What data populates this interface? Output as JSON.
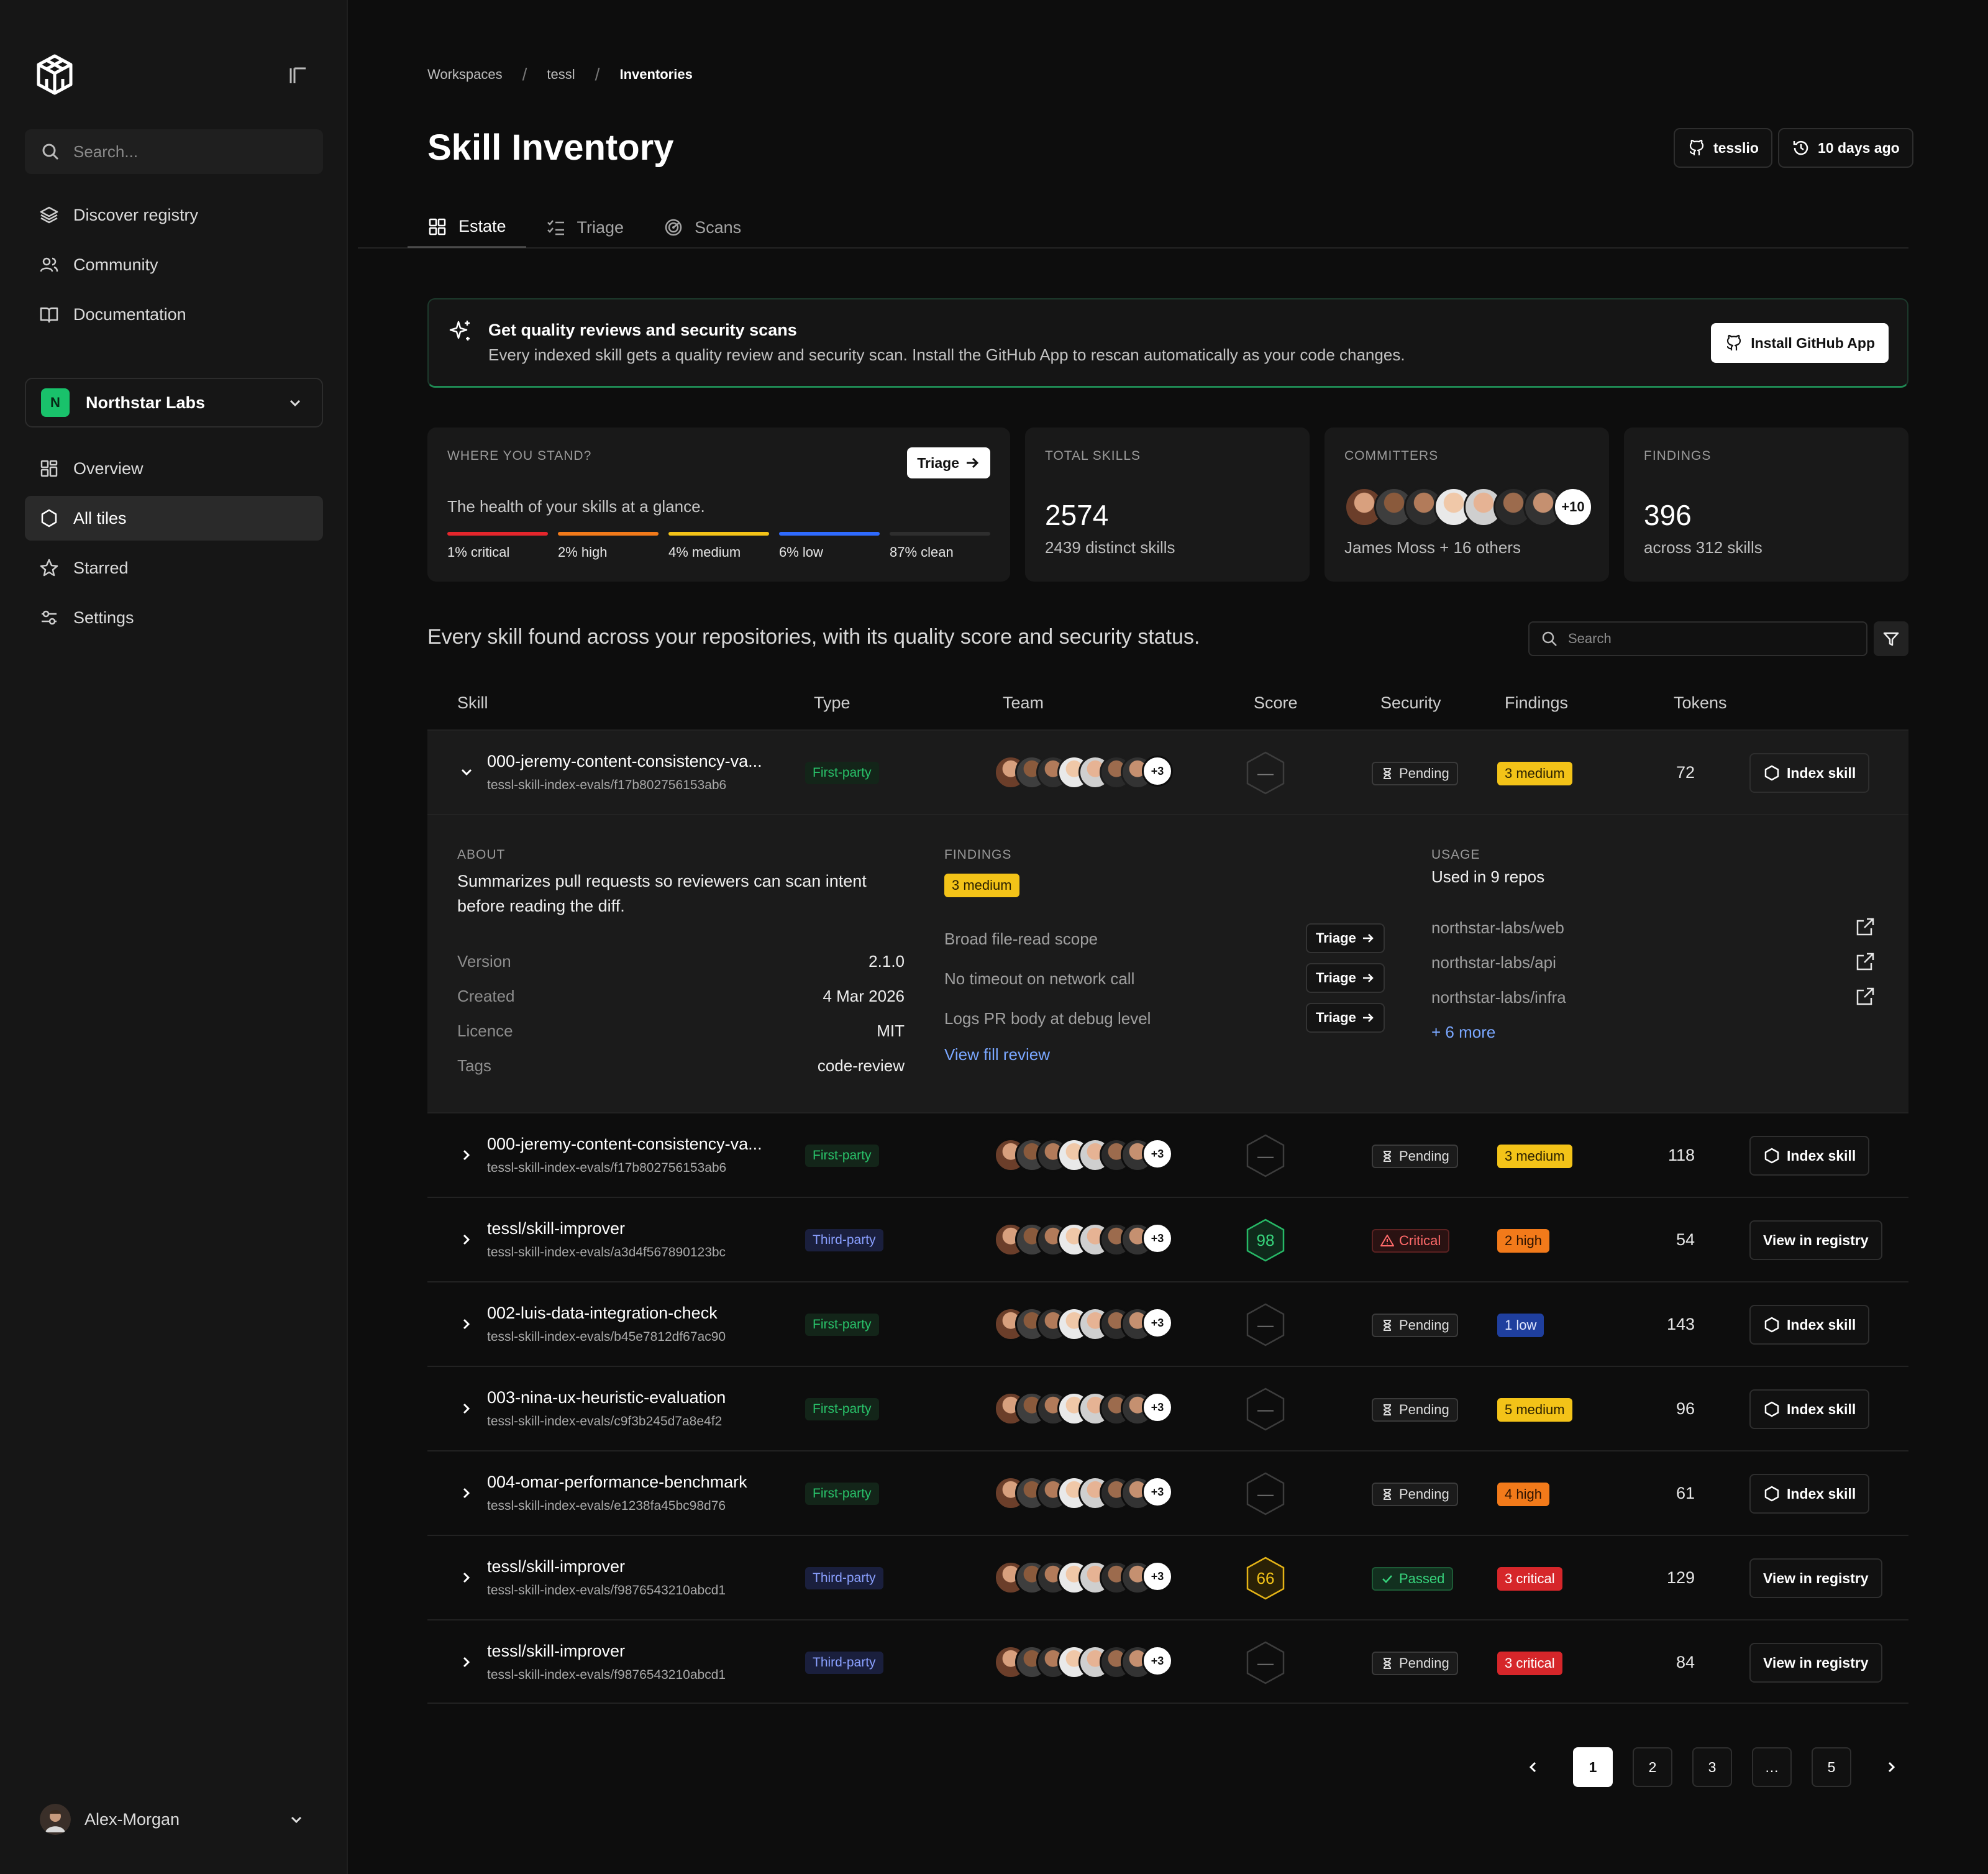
{
  "sidebar": {
    "search_placeholder": "Search...",
    "top_nav": [
      {
        "label": "Discover registry",
        "icon": "layers-icon"
      },
      {
        "label": "Community",
        "icon": "users-icon"
      },
      {
        "label": "Documentation",
        "icon": "book-icon"
      }
    ],
    "org": {
      "initial": "N",
      "name": "Northstar Labs",
      "color": "#19c26b"
    },
    "org_nav": [
      {
        "label": "Overview",
        "icon": "grid-icon",
        "active": false
      },
      {
        "label": "All tiles",
        "icon": "hexagon-icon",
        "active": true
      },
      {
        "label": "Starred",
        "icon": "star-icon",
        "active": false
      },
      {
        "label": "Settings",
        "icon": "sliders-icon",
        "active": false
      }
    ],
    "user": {
      "name": "Alex-Morgan"
    }
  },
  "breadcrumb": [
    "Workspaces",
    "tessl",
    "Inventories"
  ],
  "title": "Skill Inventory",
  "header_buttons": {
    "repo": "tesslio",
    "updated": "10 days ago"
  },
  "tabs": [
    {
      "label": "Estate",
      "icon": "grid-icon",
      "active": true
    },
    {
      "label": "Triage",
      "icon": "checklist-icon",
      "active": false
    },
    {
      "label": "Scans",
      "icon": "radar-icon",
      "active": false
    }
  ],
  "banner": {
    "title": "Get quality reviews and security scans",
    "text": "Every indexed skill gets a quality review and security scan. Install the GitHub App to rescan automatically as your code changes.",
    "button": "Install GitHub App"
  },
  "stats": {
    "health": {
      "label": "WHERE YOU STAND?",
      "button": "Triage",
      "text": "The health of your skills at a glance.",
      "segments": [
        {
          "label": "1% critical",
          "color": "#e5262c"
        },
        {
          "label": "2% high",
          "color": "#f27a1a"
        },
        {
          "label": "4% medium",
          "color": "#f3c318"
        },
        {
          "label": "6% low",
          "color": "#2f6bff"
        },
        {
          "label": "87% clean",
          "color": "#2e2e2e"
        }
      ]
    },
    "total": {
      "label": "TOTAL SKILLS",
      "value": "2574",
      "sub": "2439 distinct skills"
    },
    "committers": {
      "label": "COMMITTERS",
      "more": "+10",
      "sub": "James Moss + 16 others"
    },
    "findings": {
      "label": "FINDINGS",
      "value": "396",
      "sub": "across 312 skills"
    }
  },
  "intro": "Every skill found across your repositories, with its quality score and security status.",
  "table_search_placeholder": "Search",
  "columns": [
    "Skill",
    "Type",
    "Team",
    "Score",
    "Security",
    "Findings",
    "Tokens"
  ],
  "rows": [
    {
      "name": "000-jeremy-content-consistency-va...",
      "path": "tessl-skill-index-evals/f17b802756153ab6",
      "type": "First-party",
      "team_more": "+3",
      "score": "—",
      "security": "Pending",
      "findings": "3 medium",
      "tokens": "72",
      "action": "Index skill",
      "open": true
    },
    {
      "name": "000-jeremy-content-consistency-va...",
      "path": "tessl-skill-index-evals/f17b802756153ab6",
      "type": "First-party",
      "team_more": "+3",
      "score": "—",
      "security": "Pending",
      "findings": "3 medium",
      "tokens": "118",
      "action": "Index skill",
      "open": false
    },
    {
      "name": "tessl/skill-improver",
      "path": "tessl-skill-index-evals/a3d4f567890123bc",
      "type": "Third-party",
      "team_more": "+3",
      "score": "98",
      "security": "Critical",
      "findings": "2 high",
      "tokens": "54",
      "action": "View in registry",
      "open": false
    },
    {
      "name": "002-luis-data-integration-check",
      "path": "tessl-skill-index-evals/b45e7812df67ac90",
      "type": "First-party",
      "team_more": "+3",
      "score": "—",
      "security": "Pending",
      "findings": "1 low",
      "tokens": "143",
      "action": "Index skill",
      "open": false
    },
    {
      "name": "003-nina-ux-heuristic-evaluation",
      "path": "tessl-skill-index-evals/c9f3b245d7a8e4f2",
      "type": "First-party",
      "team_more": "+3",
      "score": "—",
      "security": "Pending",
      "findings": "5 medium",
      "tokens": "96",
      "action": "Index skill",
      "open": false
    },
    {
      "name": "004-omar-performance-benchmark",
      "path": "tessl-skill-index-evals/e1238fa45bc98d76",
      "type": "First-party",
      "team_more": "+3",
      "score": "—",
      "security": "Pending",
      "findings": "4 high",
      "tokens": "61",
      "action": "Index skill",
      "open": false
    },
    {
      "name": "tessl/skill-improver",
      "path": "tessl-skill-index-evals/f9876543210abcd1",
      "type": "Third-party",
      "team_more": "+3",
      "score": "66",
      "security": "Passed",
      "findings": "3 critical",
      "tokens": "129",
      "action": "View in registry",
      "open": false
    },
    {
      "name": "tessl/skill-improver",
      "path": "tessl-skill-index-evals/f9876543210abcd1",
      "type": "Third-party",
      "team_more": "+3",
      "score": "—",
      "security": "Pending",
      "findings": "3 critical",
      "tokens": "84",
      "action": "View in registry",
      "open": false
    }
  ],
  "detail": {
    "about_label": "ABOUT",
    "about": "Summarizes pull requests so reviewers can scan intent before reading the diff.",
    "meta": [
      {
        "k": "Version",
        "v": "2.1.0"
      },
      {
        "k": "Created",
        "v": "4 Mar 2026"
      },
      {
        "k": "Licence",
        "v": "MIT"
      },
      {
        "k": "Tags",
        "v": "code-review"
      }
    ],
    "findings_label": "FINDINGS",
    "findings_badge": "3 medium",
    "findings": [
      "Broad file-read scope",
      "No timeout on network call",
      "Logs PR body at debug level"
    ],
    "finding_button": "Triage",
    "review_link": "View fill review",
    "usage_label": "USAGE",
    "usage": "Used in 9 repos",
    "repos": [
      "northstar-labs/web",
      "northstar-labs/api",
      "northstar-labs/infra"
    ],
    "more_link": "+ 6 more"
  },
  "pagination": [
    "1",
    "2",
    "3",
    "…",
    "5"
  ],
  "pagination_active": "1"
}
